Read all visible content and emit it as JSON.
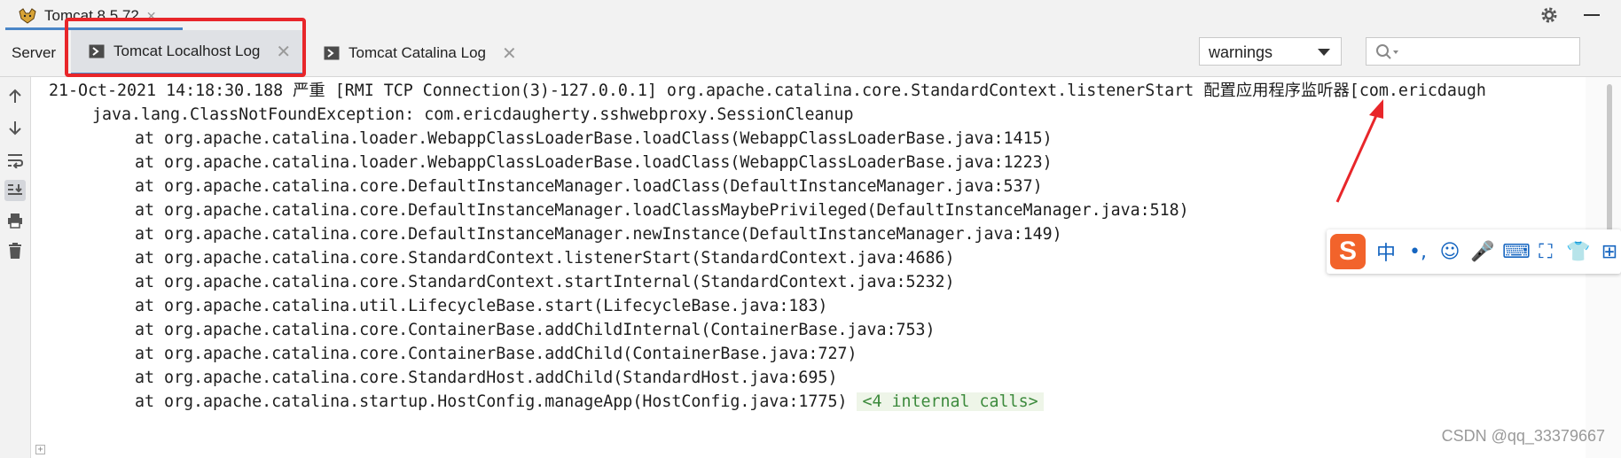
{
  "run_tab": {
    "title": "Tomcat 8.5.72",
    "close_glyph": "✕"
  },
  "tabs": {
    "server_label": "Server",
    "localhost_label": "Tomcat Localhost Log",
    "catalina_label": "Tomcat Catalina Log",
    "close_glyph": "✕"
  },
  "filter": {
    "selected": "warnings",
    "options_visible": [
      "warnings"
    ]
  },
  "search": {
    "placeholder": ""
  },
  "log_lines": [
    "21-Oct-2021 14:18:30.188 严重 [RMI TCP Connection(3)-127.0.0.1] org.apache.catalina.core.StandardContext.listenerStart 配置应用程序监听器[com.ericdaugh",
    "java.lang.ClassNotFoundException: com.ericdaugherty.sshwebproxy.SessionCleanup",
    "at org.apache.catalina.loader.WebappClassLoaderBase.loadClass(WebappClassLoaderBase.java:1415)",
    "at org.apache.catalina.loader.WebappClassLoaderBase.loadClass(WebappClassLoaderBase.java:1223)",
    "at org.apache.catalina.core.DefaultInstanceManager.loadClass(DefaultInstanceManager.java:537)",
    "at org.apache.catalina.core.DefaultInstanceManager.loadClassMaybePrivileged(DefaultInstanceManager.java:518)",
    "at org.apache.catalina.core.DefaultInstanceManager.newInstance(DefaultInstanceManager.java:149)",
    "at org.apache.catalina.core.StandardContext.listenerStart(StandardContext.java:4686)",
    "at org.apache.catalina.core.StandardContext.startInternal(StandardContext.java:5232)",
    "at org.apache.catalina.util.LifecycleBase.start(LifecycleBase.java:183)",
    "at org.apache.catalina.core.ContainerBase.addChildInternal(ContainerBase.java:753)",
    "at org.apache.catalina.core.ContainerBase.addChild(ContainerBase.java:727)",
    "at org.apache.catalina.core.StandardHost.addChild(StandardHost.java:695)",
    "at org.apache.catalina.startup.HostConfig.manageApp(HostConfig.java:1775) "
  ],
  "internal_calls": "<4 internal calls>",
  "ime": {
    "logo": "S",
    "items": [
      "中",
      "•,",
      "☺",
      "🎤",
      "⌨",
      "⛶",
      "👕",
      "⊞"
    ]
  },
  "icons": [
    "tomcat-icon",
    "gear-icon",
    "minimize-icon",
    "console-tab-icon",
    "chevron-down-icon",
    "search-icon",
    "arrow-up-icon",
    "arrow-down-icon",
    "soft-wrap-icon",
    "scroll-to-end-icon",
    "print-icon",
    "trash-icon"
  ],
  "colors": {
    "highlight": "#e8262a",
    "accent": "#4a86c7",
    "ime_logo": "#f2632b"
  },
  "watermark": "CSDN @qq_33379667"
}
